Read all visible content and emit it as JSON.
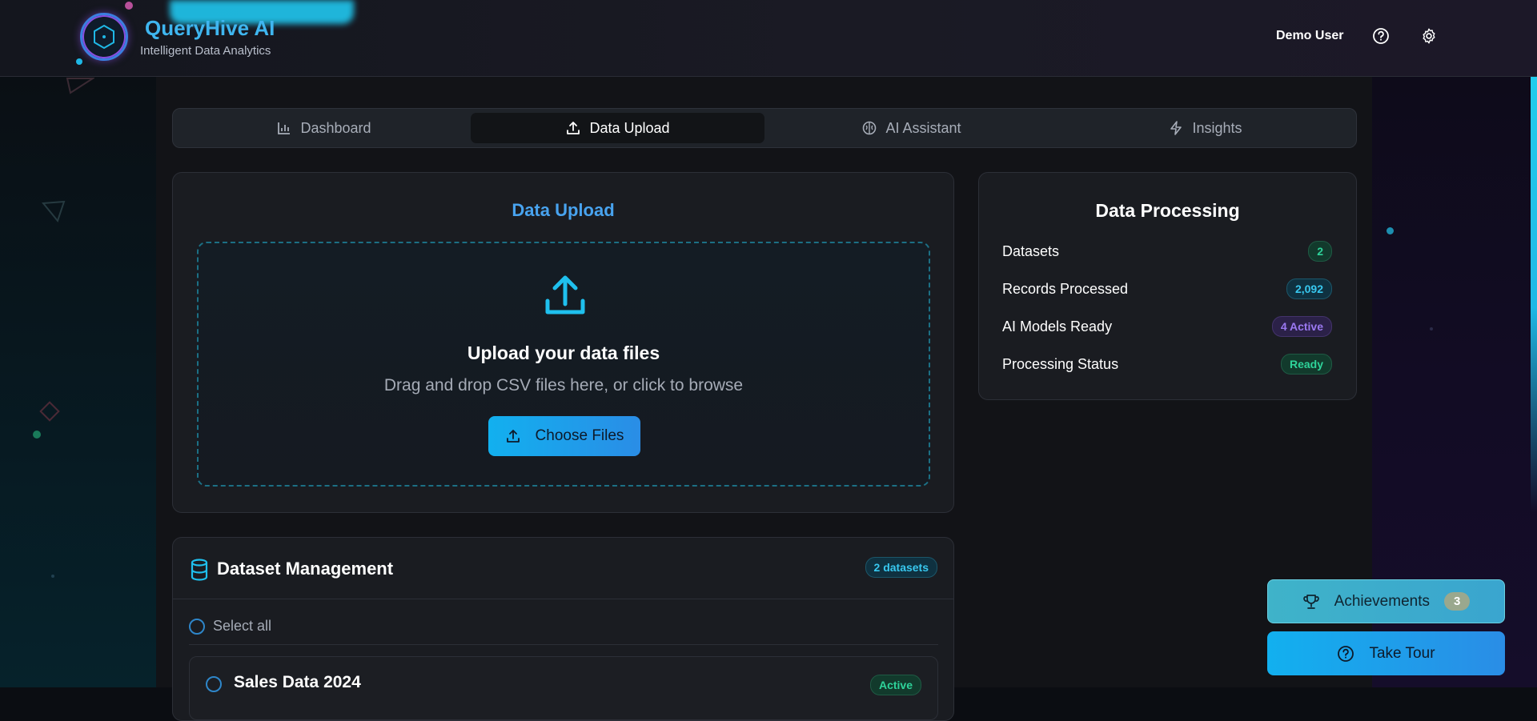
{
  "header": {
    "brand_title": "QueryHive AI",
    "brand_subtitle": "Intelligent Data Analytics",
    "user_name": "Demo User",
    "icons": [
      "help-circle-icon",
      "gear-icon"
    ]
  },
  "tabs": [
    {
      "label": "Dashboard",
      "icon": "bar-chart-icon",
      "active": false
    },
    {
      "label": "Data Upload",
      "icon": "upload-icon",
      "active": true
    },
    {
      "label": "AI Assistant",
      "icon": "brain-icon",
      "active": false
    },
    {
      "label": "Insights",
      "icon": "lightning-icon",
      "active": false
    }
  ],
  "upload": {
    "title": "Data Upload",
    "drop_title": "Upload your data files",
    "drop_subtitle": "Drag and drop CSV files here, or click to browse",
    "button_label": "Choose Files"
  },
  "processing": {
    "title": "Data Processing",
    "rows": [
      {
        "label": "Datasets",
        "value": "2",
        "color": "green"
      },
      {
        "label": "Records Processed",
        "value": "2,092",
        "color": "cyan"
      },
      {
        "label": "AI Models Ready",
        "value": "4 Active",
        "color": "purple"
      },
      {
        "label": "Processing Status",
        "value": "Ready",
        "color": "green"
      }
    ]
  },
  "datasets": {
    "title": "Dataset Management",
    "count_badge": "2 datasets",
    "select_all": "Select all",
    "items": [
      {
        "name": "Sales Data 2024",
        "status": "Active"
      }
    ]
  },
  "floating": {
    "achievements_label": "Achievements",
    "achievements_count": "3",
    "tour_label": "Take Tour"
  },
  "colors": {
    "accent": "#12b0ef",
    "brand": "#3fb6f0",
    "success": "#2ed39a",
    "purple": "#9b79f1"
  }
}
